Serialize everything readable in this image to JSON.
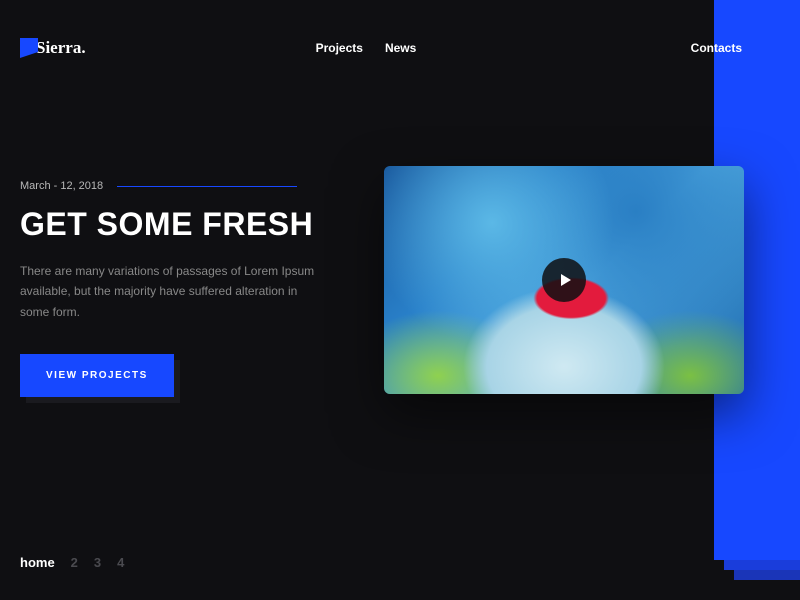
{
  "brand": {
    "name": "Sierra."
  },
  "nav": {
    "center": [
      {
        "label": "Projects"
      },
      {
        "label": "News"
      }
    ],
    "right": {
      "label": "Contacts"
    }
  },
  "hero": {
    "date": "March - 12, 2018",
    "title": "GET SOME FRESH",
    "description": "There are many variations of passages of Lorem Ipsum available, but the majority have suffered alteration in some form.",
    "cta_label": "VIEW PROJECTS"
  },
  "pager": {
    "items": [
      {
        "label": "home",
        "active": true
      },
      {
        "label": "2",
        "active": false
      },
      {
        "label": "3",
        "active": false
      },
      {
        "label": "4",
        "active": false
      }
    ]
  },
  "colors": {
    "accent": "#1748ff",
    "bg": "#0f0f12"
  }
}
